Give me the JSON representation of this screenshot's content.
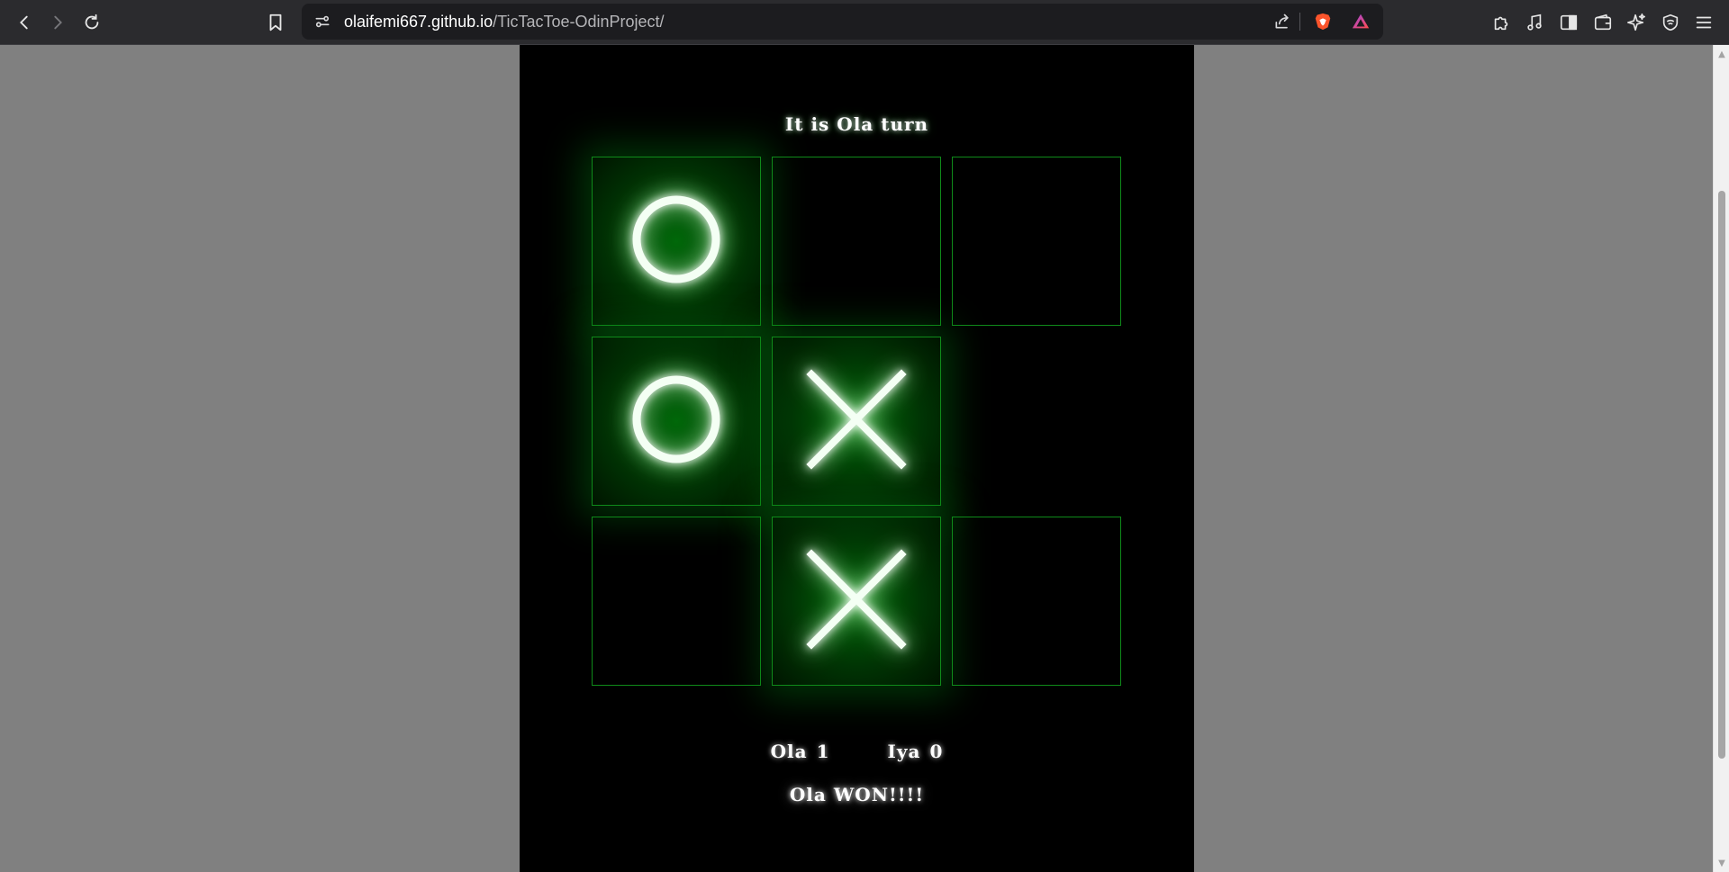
{
  "browser": {
    "url_domain": "olaifemi667.github.io",
    "url_path": "/TicTacToe-OdinProject/"
  },
  "game": {
    "turn_text": "It is Ola turn",
    "board": [
      [
        "O",
        "",
        ""
      ],
      [
        "O",
        "X",
        ""
      ],
      [
        "",
        "X",
        ""
      ]
    ],
    "scores": [
      {
        "name": "Ola",
        "value": "1"
      },
      {
        "name": "Iya",
        "value": "0"
      }
    ],
    "result_text": "Ola WON!!!!"
  },
  "colors": {
    "page_bg": "#808080",
    "game_bg": "#000000",
    "cell_border": "#0f8a1a",
    "glow": "#00ff3c"
  }
}
